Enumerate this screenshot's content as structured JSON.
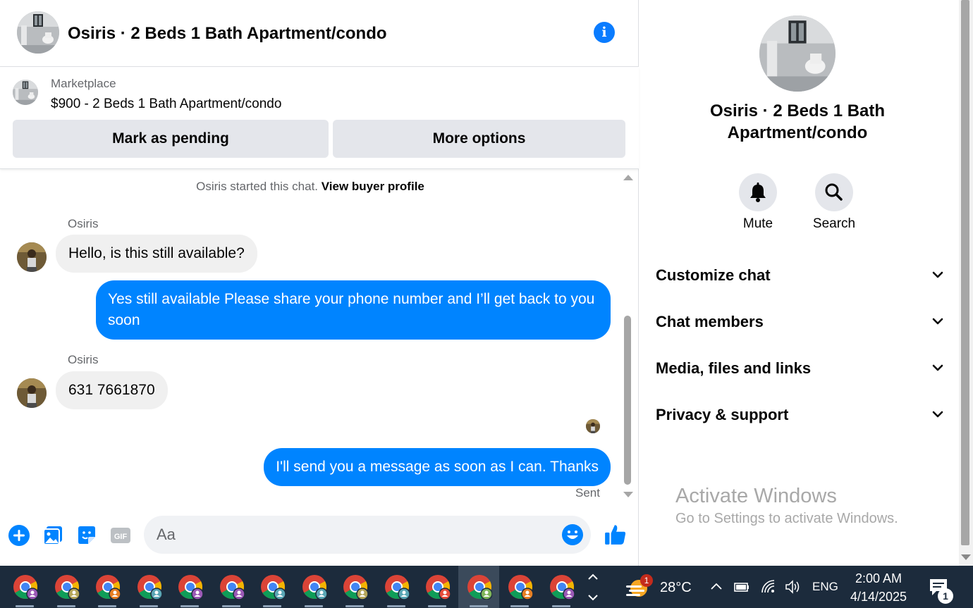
{
  "chat": {
    "title": "Osiris · 2 Beds 1 Bath Apartment/condo",
    "info_icon": "info-icon"
  },
  "listing": {
    "source": "Marketplace",
    "price_title": "$900 - 2 Beds 1 Bath Apartment/condo",
    "mark_pending_label": "Mark as pending",
    "more_options_label": "More options"
  },
  "messages": {
    "system_note": "Osiris started this chat.",
    "system_link": "View buyer profile",
    "sender_1": "Osiris",
    "msg_1": "Hello, is this still available?",
    "msg_2": "Yes still available Please share your phone number and I’ll get back to you soon",
    "sender_2": "Osiris",
    "msg_3": "631 7661870",
    "msg_4": "I'll send you a message as soon as I can. Thanks",
    "status": "Sent"
  },
  "composer": {
    "placeholder": "Aa",
    "icons": [
      "plus-icon",
      "photo-icon",
      "sticker-icon",
      "gif-icon",
      "emoji-icon",
      "thumbs-up-icon"
    ],
    "gif_label": "GIF"
  },
  "info_panel": {
    "name": "Osiris · 2 Beds 1 Bath Apartment/condo",
    "mute_label": "Mute",
    "search_label": "Search",
    "sections": [
      "Customize chat",
      "Chat members",
      "Media, files and links",
      "Privacy & support"
    ]
  },
  "watermark": {
    "title": "Activate Windows",
    "subtitle": "Go to Settings to activate Windows."
  },
  "taskbar": {
    "app_count": 14,
    "weather_badge": "1",
    "temperature": "28°C",
    "language": "ENG",
    "time": "2:00 AM",
    "date": "4/14/2025",
    "notification_count": "1"
  },
  "colors": {
    "accent_blue": "#0084ff",
    "info_blue": "#0a7cff",
    "taskbar": "#1c2b3c"
  }
}
